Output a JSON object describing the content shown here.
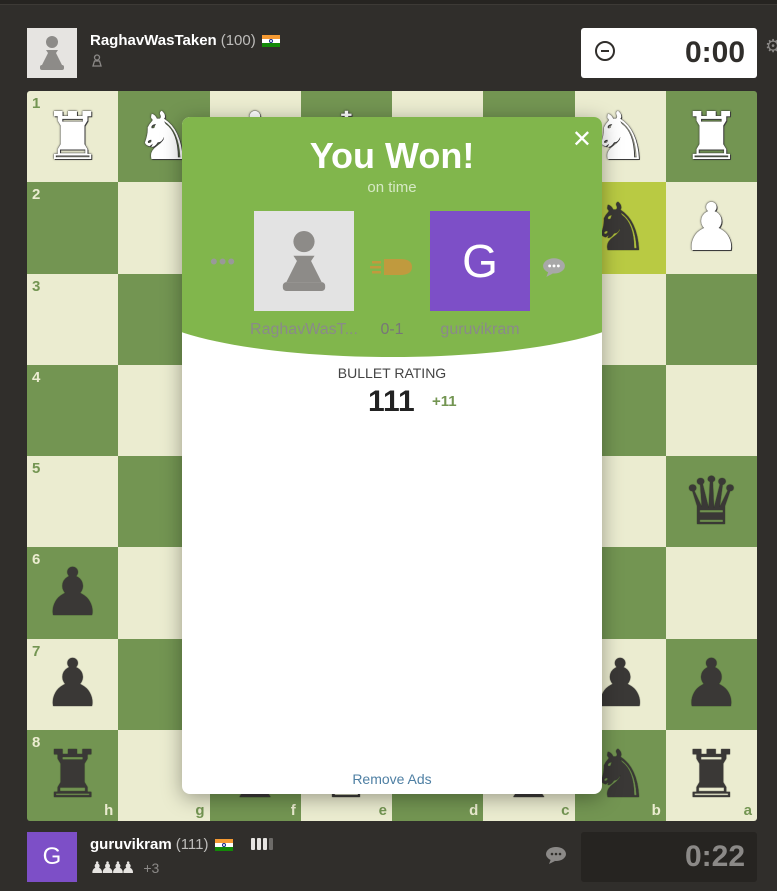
{
  "top_player": {
    "name": "RaghavWasTaken",
    "rating": "(100)",
    "clock": "0:00"
  },
  "bottom_player": {
    "avatar_letter": "G",
    "name": "guruvikram",
    "rating": "(111)",
    "captured_material": "+3",
    "clock": "0:22"
  },
  "board": {
    "ranks": [
      "1",
      "2",
      "3",
      "4",
      "5",
      "6",
      "7",
      "8"
    ],
    "files": [
      "h",
      "g",
      "f",
      "e",
      "d",
      "c",
      "b",
      "a"
    ],
    "last_move_highlight": "b2",
    "colors": {
      "light": "#ebecd0",
      "dark": "#739552",
      "highlight": "#b9ca43"
    }
  },
  "modal": {
    "title": "You Won!",
    "subtitle": "on time",
    "left_player_label": "RaghavWasT...",
    "score": "0-1",
    "right_player_label": "guruvikram",
    "right_player_letter": "G",
    "rating_label": "BULLET RATING",
    "rating_value": "111",
    "rating_delta": "+11",
    "remove_ads": "Remove Ads",
    "accent_color": "#81b64c"
  }
}
